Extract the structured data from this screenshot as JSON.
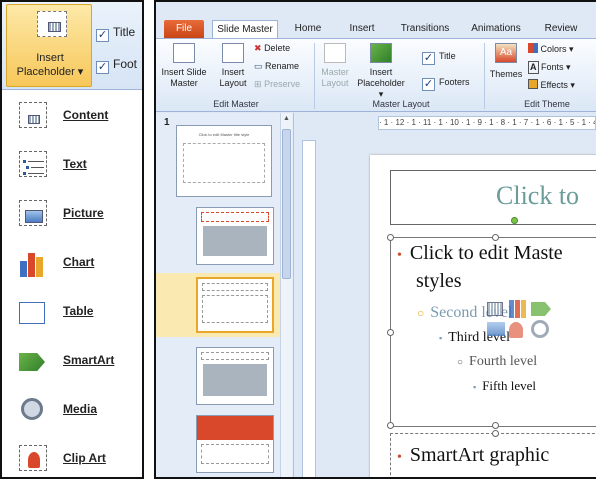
{
  "left_panel": {
    "insert_placeholder_label": "Insert Placeholder ▾",
    "title_checkbox": "Title",
    "footers_checkbox": "Foot",
    "menu_items": [
      {
        "label": "Content",
        "icon": "content-placeholder-icon"
      },
      {
        "label": "Text",
        "icon": "text-placeholder-icon"
      },
      {
        "label": "Picture",
        "icon": "picture-placeholder-icon"
      },
      {
        "label": "Chart",
        "icon": "chart-placeholder-icon"
      },
      {
        "label": "Table",
        "icon": "table-placeholder-icon"
      },
      {
        "label": "SmartArt",
        "icon": "smartart-placeholder-icon"
      },
      {
        "label": "Media",
        "icon": "media-placeholder-icon"
      },
      {
        "label": "Clip Art",
        "icon": "clip-art-placeholder-icon"
      }
    ]
  },
  "ribbon": {
    "tabs": [
      "File",
      "Slide Master",
      "Home",
      "Insert",
      "Transitions",
      "Animations",
      "Review"
    ],
    "edit_master": {
      "insert_slide_master": "Insert Slide Master",
      "insert_layout": "Insert Layout",
      "delete": "Delete",
      "rename": "Rename",
      "preserve": "Preserve",
      "group_label": "Edit Master"
    },
    "master_layout": {
      "master_layout": "Master Layout",
      "insert_placeholder": "Insert Placeholder ▾",
      "title": "Title",
      "footers": "Footers",
      "group_label": "Master Layout"
    },
    "edit_theme": {
      "themes": "Themes",
      "colors": "Colors ▾",
      "fonts": "Fonts ▾",
      "effects": "Effects ▾",
      "group_label": "Edit Theme"
    }
  },
  "thumbnails": {
    "slide_number": "1",
    "thumb_title": "Click to edit Master title style"
  },
  "ruler": {
    "horizontal": "· 1 · 12 · 1 · 11 · 1 · 10 · 1 · 9 · 1 · 8 · 1 · 7 · 1 · 6 · 1 · 5 · 1 · 4 · 1"
  },
  "slide": {
    "title": "Click to",
    "level1": "Click to edit Maste",
    "level1_cont": "styles",
    "level2": "Second level",
    "level3": "Third level",
    "level4": "Fourth level",
    "level5": "Fifth level",
    "smartart": "SmartArt graphic"
  },
  "colors": {
    "accent_orange": "#c94516",
    "highlight_gold": "#f7c75a",
    "title_teal": "#6a9c9a",
    "bullet_red": "#c9472a"
  }
}
